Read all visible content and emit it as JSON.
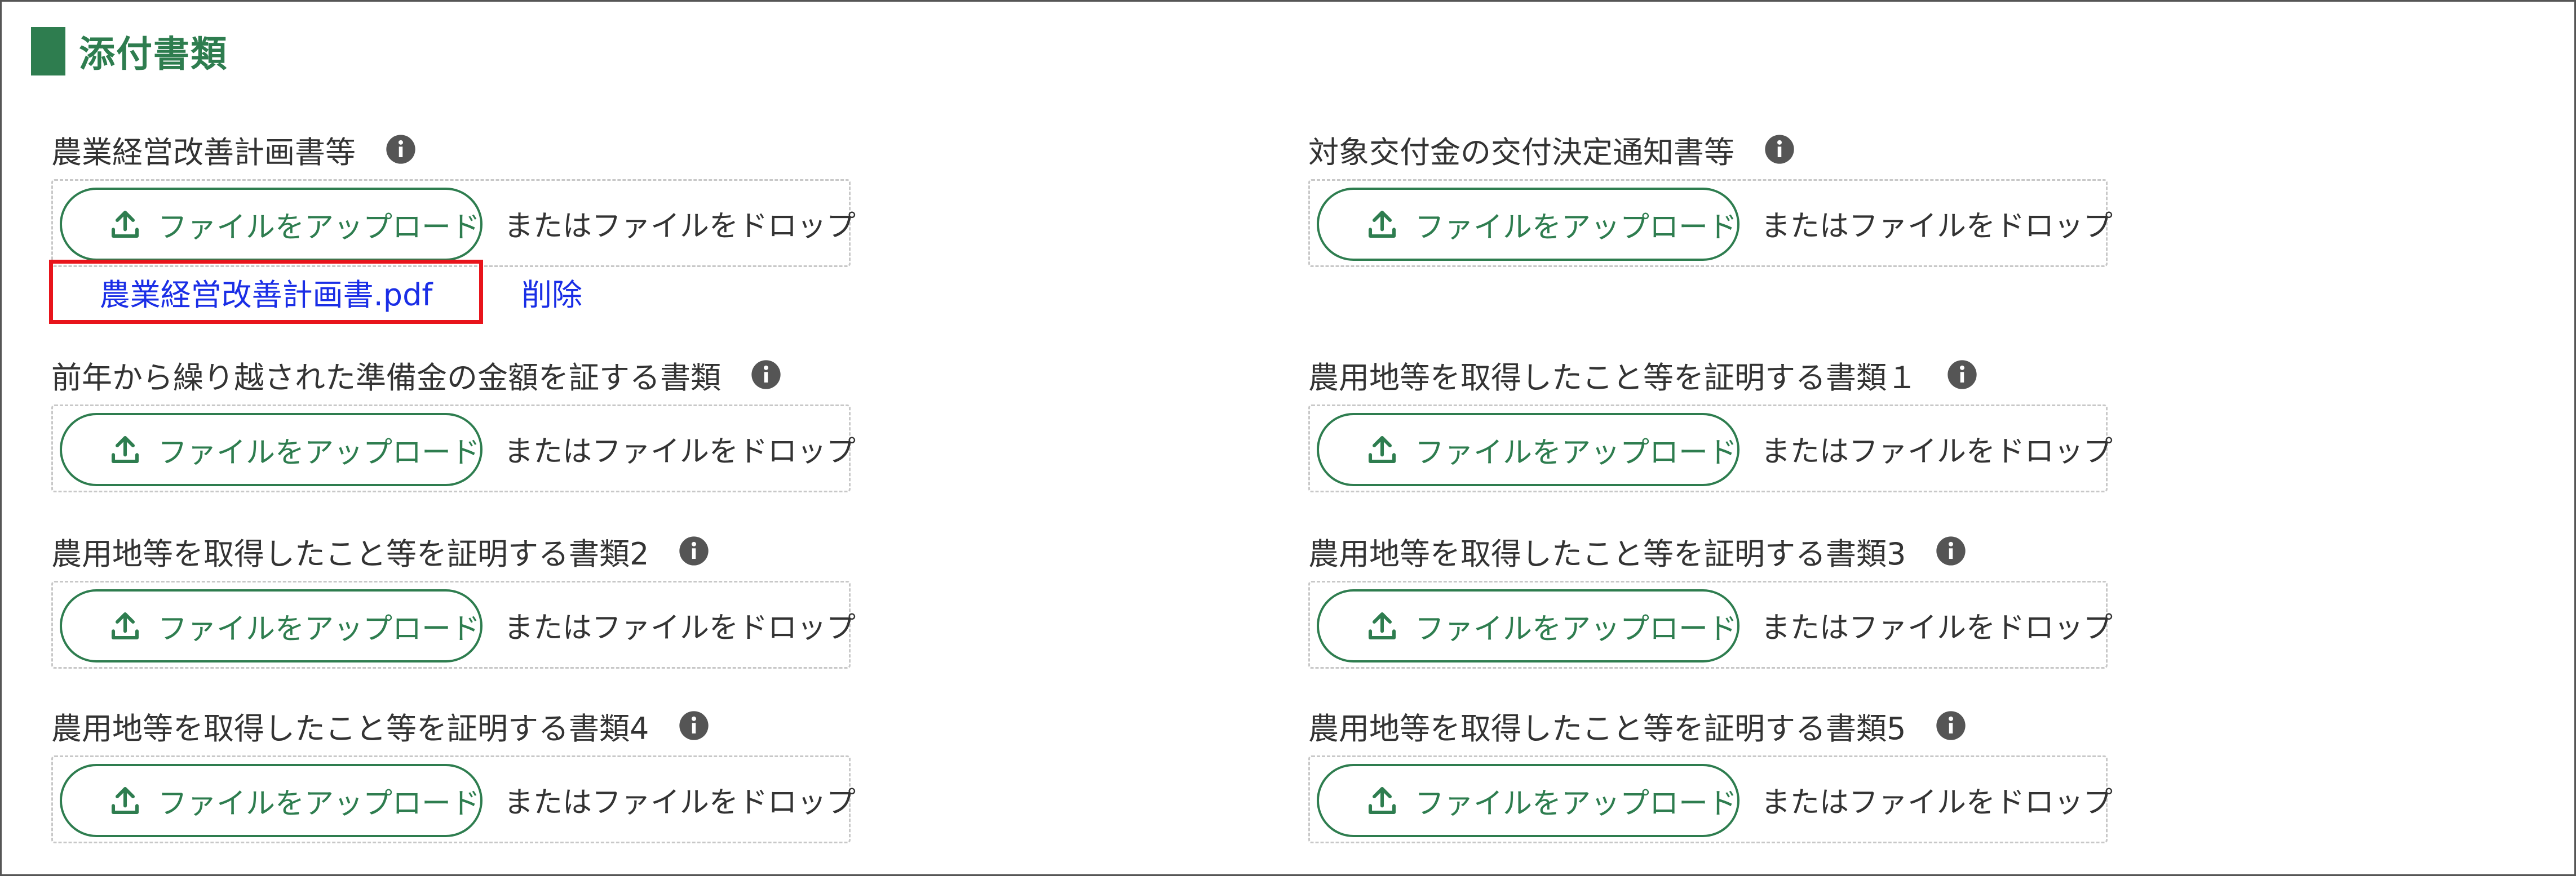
{
  "section": {
    "title": "添付書類",
    "accent_color": "#2e7d4f"
  },
  "upload_button_label": "ファイルをアップロード",
  "drop_hint": "またはファイルをドロップ",
  "fields": [
    {
      "id": "f1",
      "label": "農業経営改善計画書等"
    },
    {
      "id": "f2",
      "label": "対象交付金の交付決定通知書等"
    },
    {
      "id": "f3",
      "label": "前年から繰り越された準備金の金額を証する書類"
    },
    {
      "id": "f4",
      "label": "農用地等を取得したこと等を証明する書類１"
    },
    {
      "id": "f5",
      "label": "農用地等を取得したこと等を証明する書類2"
    },
    {
      "id": "f6",
      "label": "農用地等を取得したこと等を証明する書類3"
    },
    {
      "id": "f7",
      "label": "農用地等を取得したこと等を証明する書類4"
    },
    {
      "id": "f8",
      "label": "農用地等を取得したこと等を証明する書類5"
    }
  ],
  "attached_file": {
    "file_name": "農業経営改善計画書.pdf",
    "delete_label": "削除",
    "highlight_color": "#e8141b",
    "link_color": "#1a2ee6"
  },
  "icons": {
    "info": "info-icon",
    "upload": "upload-icon"
  }
}
